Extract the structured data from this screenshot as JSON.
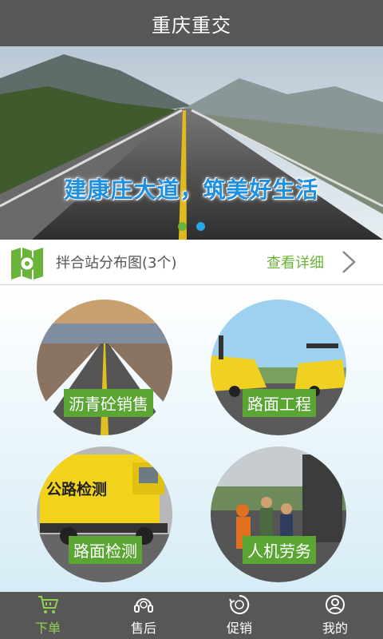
{
  "app": {
    "title": "重庆重交"
  },
  "banner": {
    "slogan": "建康庄大道，筑美好生活",
    "dots": [
      {
        "color": "#6bb43a"
      },
      {
        "color": "#29a8e6"
      }
    ]
  },
  "map_bar": {
    "label": "拌合站分布图(3个)",
    "link": "查看详细",
    "icon": "map-icon"
  },
  "tiles": [
    {
      "label": "沥青砼销售"
    },
    {
      "label": "路面工程"
    },
    {
      "label": "路面检测"
    },
    {
      "label": "人机劳务"
    }
  ],
  "truck_sign": "公路检测",
  "tabs": [
    {
      "label": "下单",
      "icon": "cart-icon",
      "active": true
    },
    {
      "label": "售后",
      "icon": "headset-icon",
      "active": false
    },
    {
      "label": "促销",
      "icon": "promo-icon",
      "active": false
    },
    {
      "label": "我的",
      "icon": "user-icon",
      "active": false
    }
  ],
  "colors": {
    "accent": "#6bb43a",
    "bar": "#575757",
    "label_bg": "#5aa534"
  }
}
